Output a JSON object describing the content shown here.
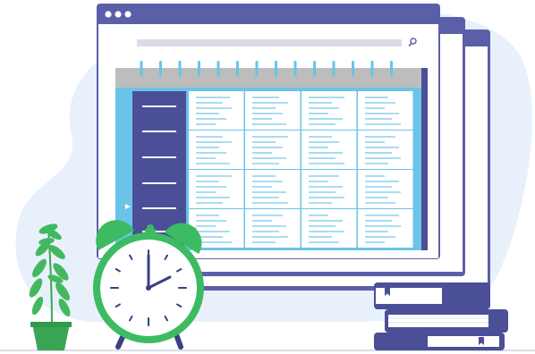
{
  "scene": {
    "title": "",
    "colors": {
      "background_blob": "#e8f1fb",
      "window_chrome": "#5b5fa8",
      "window_body": "#ffffff",
      "search_bar": "#d9dce8",
      "calendar_header": "#bdbdbd",
      "calendar_frame": "#6bc3e8",
      "calendar_sidebar": "#4a4f97",
      "calendar_accent_column": "#4a4f97",
      "spiral_rings": "#6bc3e8",
      "cell_lines": "#a9dcf3",
      "clock_ring": "#3dbb63",
      "clock_face": "#ffffff",
      "clock_hands": "#3a3f86",
      "plant_leaves": "#43b85f",
      "plant_pot": "#3aa655",
      "book_cover": "#4a4f97",
      "book_pages": "#ffffff",
      "ground_line": "#d8dde8"
    },
    "icons": [
      "window-dots-icon",
      "search-icon",
      "calendar-icon",
      "alarm-clock-icon",
      "plant-icon",
      "books-icon",
      "bookmark-icon"
    ],
    "calendar": {
      "spiral_ring_count": 14,
      "rows": 4,
      "columns": 4
    },
    "clock_time": "3:00"
  }
}
